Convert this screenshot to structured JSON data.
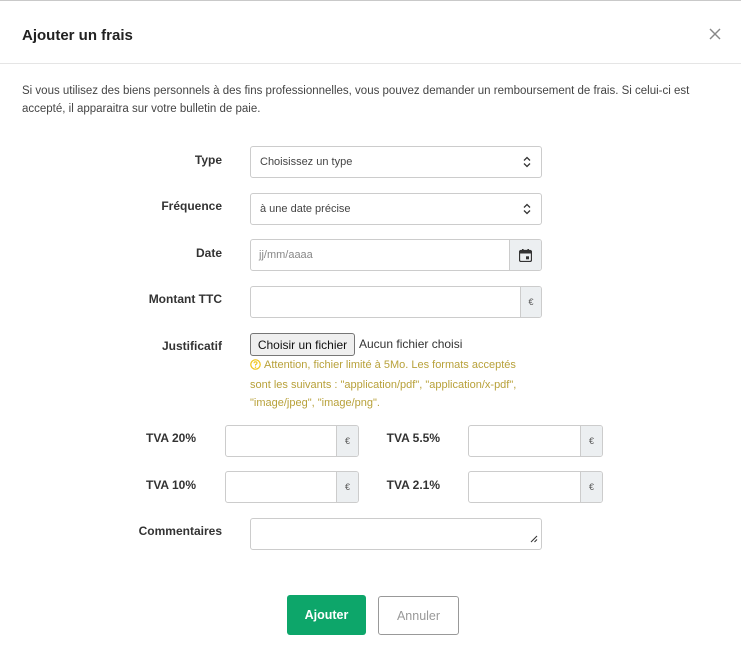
{
  "modal": {
    "title": "Ajouter un frais",
    "intro": "Si vous utilisez des biens personnels à des fins professionnelles, vous pouvez demander un remboursement de frais. Si celui-ci est accepté, il apparaitra sur votre bulletin de paie."
  },
  "form": {
    "type": {
      "label": "Type",
      "value": "Choisissez un type"
    },
    "frequency": {
      "label": "Fréquence",
      "value": "à une date précise"
    },
    "date": {
      "label": "Date",
      "placeholder": "jj/mm/aaaa"
    },
    "amount": {
      "label": "Montant TTC",
      "value": "",
      "currency": "€"
    },
    "receipt": {
      "label": "Justificatif",
      "button": "Choisir un fichier",
      "status": "Aucun fichier choisi",
      "hint": "Attention, fichier limité à 5Mo. Les formats acceptés sont les suivants : \"application/pdf\", \"application/x-pdf\", \"image/jpeg\", \"image/png\"."
    },
    "vat": [
      {
        "label": "TVA 20%",
        "value": "",
        "currency": "€"
      },
      {
        "label": "TVA 5.5%",
        "value": "",
        "currency": "€"
      },
      {
        "label": "TVA 10%",
        "value": "",
        "currency": "€"
      },
      {
        "label": "TVA 2.1%",
        "value": "",
        "currency": "€"
      }
    ],
    "comments": {
      "label": "Commentaires",
      "value": ""
    }
  },
  "actions": {
    "submit": "Ajouter",
    "cancel": "Annuler"
  },
  "colors": {
    "primary": "#0da66a",
    "warning": "#f0c419"
  },
  "icons": {
    "close": "close-icon",
    "select": "chevron-up-down-icon",
    "calendar": "calendar-icon",
    "hint": "help-circle-icon",
    "resize": "resize-handle-icon"
  }
}
